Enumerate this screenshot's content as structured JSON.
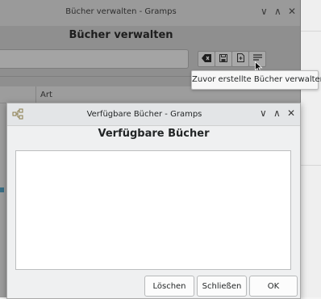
{
  "manage_window": {
    "title": "Bücher verwalten - Gramps",
    "heading": "Bücher verwalten",
    "column_type": "Art",
    "controls": {
      "minimize": "∨",
      "maximize": "∧",
      "close": "✕"
    }
  },
  "tooltip": {
    "text": "Zuvor erstellte Bücher verwalten"
  },
  "available_dialog": {
    "title": "Verfügbare Bücher - Gramps",
    "heading": "Verfügbare Bücher",
    "controls": {
      "minimize": "∨",
      "maximize": "∧",
      "close": "✕"
    },
    "buttons": {
      "delete": "Löschen",
      "close": "Schließen",
      "ok": "OK"
    }
  },
  "icons": [
    "clear-icon",
    "save-icon",
    "open-book-icon",
    "manage-books-icon",
    "gramps-app-icon",
    "mouse-cursor-icon"
  ]
}
